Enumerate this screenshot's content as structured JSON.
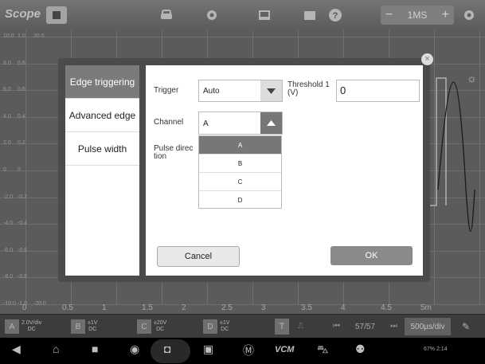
{
  "app": {
    "logo": "Scope"
  },
  "toolbar": {
    "icons": [
      "stop-icon",
      "car-icon",
      "gear-icon",
      "screen-icon",
      "folder-icon",
      "help-icon",
      "settings-icon"
    ],
    "timebase": {
      "minus": "−",
      "value": "1MS",
      "plus": "+"
    }
  },
  "scope": {
    "y_labels_a": [
      "10.0",
      "8.0",
      "6.0",
      "4.0",
      "2.0",
      "0",
      "-2.0",
      "-4.0",
      "-6.0",
      "-8.0",
      "-10.0"
    ],
    "y_labels_b": [
      "1.0",
      "0.8",
      "0.6",
      "0.4",
      "0.2",
      "0",
      "-0.2",
      "-0.4",
      "-0.6",
      "-0.8",
      "-1.0"
    ],
    "y_labels_c": [
      "20.0",
      "",
      "",
      "",
      "",
      "",
      "",
      "",
      "",
      "",
      "-20.0"
    ],
    "x_labels": [
      "0",
      "0.5",
      "1",
      "1.5",
      "2",
      "2.5",
      "3",
      "3.5",
      "4",
      "4.5",
      "5m"
    ],
    "marker_right": "4"
  },
  "dialog": {
    "tabs": [
      "Edge triggering",
      "Advanced edge",
      "Pulse width"
    ],
    "trigger_label": "Trigger",
    "trigger_value": "Auto",
    "threshold_label": "Threshold 1\n(V)",
    "threshold_value": "0",
    "channel_label": "Channel",
    "channel_value": "A",
    "pulse_label": "Pulse direc\ntion",
    "channel_options": [
      "A",
      "B",
      "C",
      "D"
    ],
    "cancel": "Cancel",
    "ok": "OK",
    "close": "×"
  },
  "channels": [
    {
      "name": "A",
      "sub": "X1",
      "line1": "2.0V/div",
      "line2": "DC"
    },
    {
      "name": "B",
      "sub": "X1",
      "line1": "±1V",
      "line2": "DC"
    },
    {
      "name": "C",
      "sub": "X1",
      "line1": "±20V",
      "line2": "DC"
    },
    {
      "name": "D",
      "sub": "X1",
      "line1": "±1V",
      "line2": "DC"
    }
  ],
  "bottom": {
    "T": "T",
    "page": "57/57",
    "timebase": "500µs/div"
  },
  "status": {
    "text": "67%",
    "time": "2:14"
  }
}
